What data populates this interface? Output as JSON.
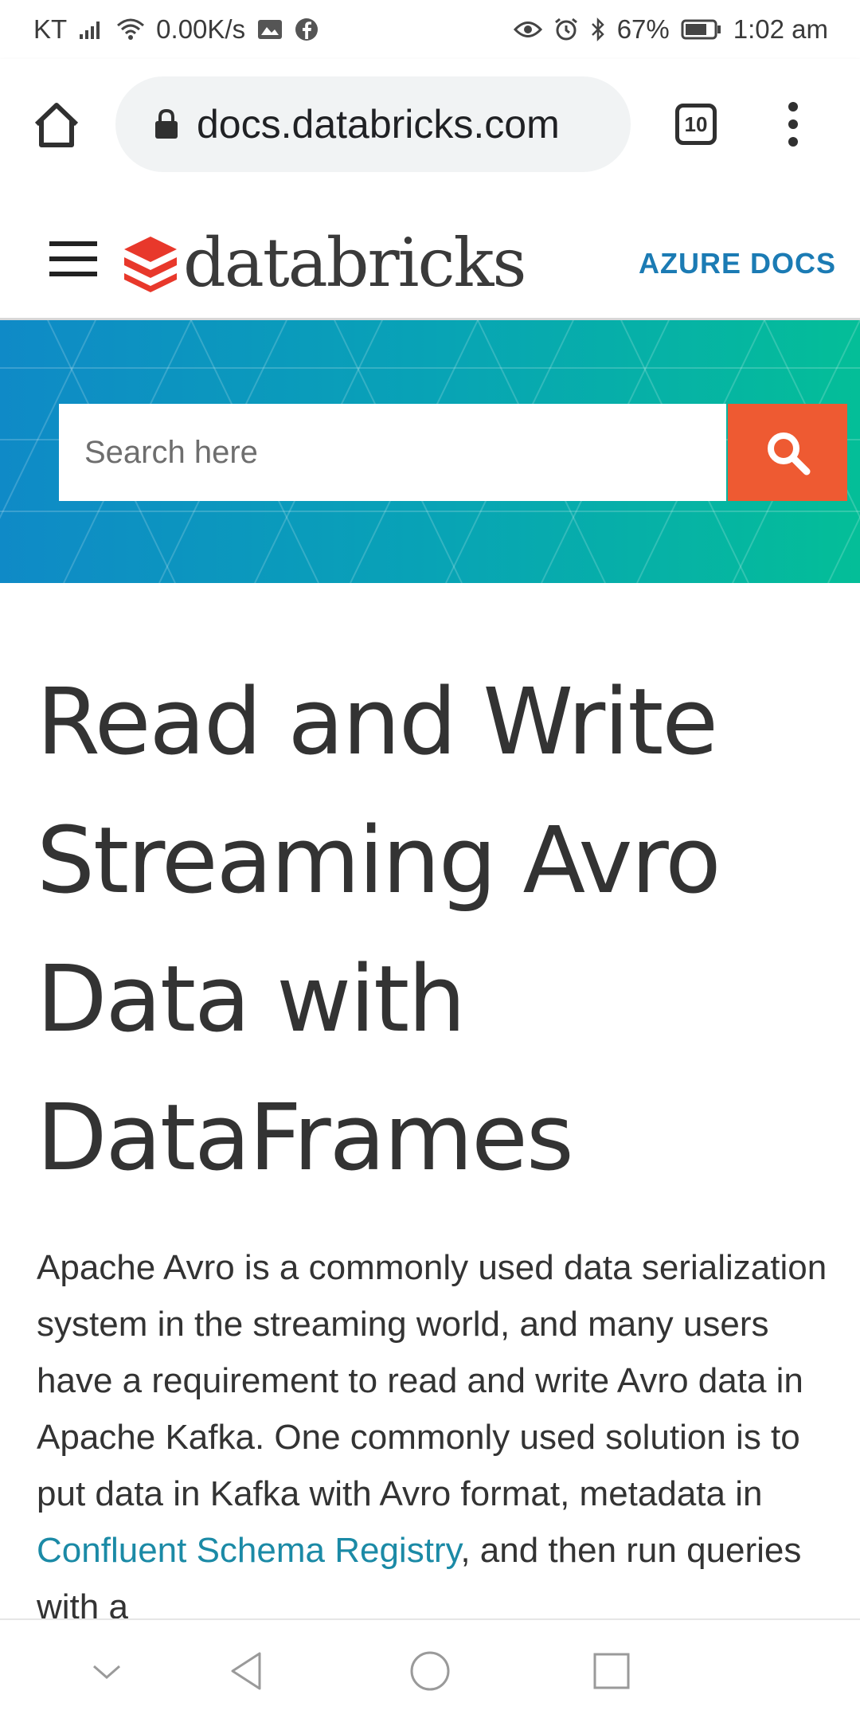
{
  "status_bar": {
    "carrier": "KT",
    "net_speed": "0.00K/s",
    "battery": "67%",
    "time": "1:02 am"
  },
  "browser": {
    "url": "docs.databricks.com",
    "tab_count": "10"
  },
  "site_header": {
    "logo_text": "databricks",
    "nav_link": "AZURE DOCS"
  },
  "search": {
    "placeholder": "Search here"
  },
  "article": {
    "title": "Read and Write Streaming Avro Data with DataFrames",
    "body_before_link": "Apache Avro is a commonly used data serialization system in the streaming world, and many users have a requirement to read and write Avro data in Apache Kafka. One commonly used solution is to put data in Kafka with Avro format, metadata in ",
    "link_text": "Confluent Schema Registry",
    "body_after_link": ", and then run queries with a"
  },
  "colors": {
    "accent_link": "#1b7bb4",
    "search_button": "#ee5a32",
    "brand_red": "#e8382b",
    "hero_gradient_start": "#0f8ac7",
    "hero_gradient_end": "#04be98"
  }
}
